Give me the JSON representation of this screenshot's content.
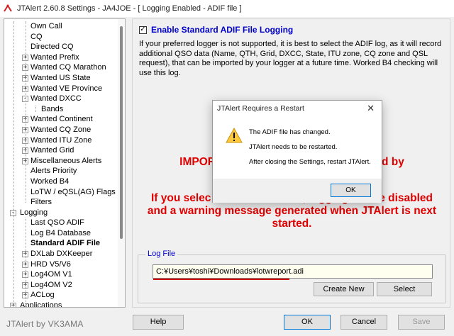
{
  "window": {
    "title": "JTAlert 2.60.8 Settings  -  JA4JOE  -  [ Logging Enabled - ADIF file ]"
  },
  "tree": {
    "items": [
      {
        "label": "Own Call"
      },
      {
        "label": "CQ"
      },
      {
        "label": "Directed CQ"
      },
      {
        "label": "Wanted Prefix",
        "expander": "+"
      },
      {
        "label": "Wanted CQ Marathon",
        "expander": "+"
      },
      {
        "label": "Wanted US State",
        "expander": "+"
      },
      {
        "label": "Wanted VE Province",
        "expander": "+"
      },
      {
        "label": "Wanted DXCC",
        "expander": "-"
      },
      {
        "label": "Bands"
      },
      {
        "label": "Wanted Continent",
        "expander": "+"
      },
      {
        "label": "Wanted CQ Zone",
        "expander": "+"
      },
      {
        "label": "Wanted ITU Zone",
        "expander": "+"
      },
      {
        "label": "Wanted Grid",
        "expander": "+"
      },
      {
        "label": "Miscellaneous Alerts",
        "expander": "+"
      },
      {
        "label": "Alerts Priority"
      },
      {
        "label": "Worked B4"
      },
      {
        "label": "LoTW / eQSL(AG) Flags"
      },
      {
        "label": "Filters"
      },
      {
        "label": "Logging",
        "expander": "-"
      },
      {
        "label": "Last QSO ADIF"
      },
      {
        "label": "Log B4 Database"
      },
      {
        "label": "Standard ADIF File",
        "selected": true
      },
      {
        "label": "DXLab DXKeeper",
        "expander": "+"
      },
      {
        "label": "HRD V5/V6",
        "expander": "+"
      },
      {
        "label": "Log4OM V1",
        "expander": "+"
      },
      {
        "label": "Log4OM V2",
        "expander": "+"
      },
      {
        "label": "ACLog",
        "expander": "+"
      },
      {
        "label": "Applications",
        "expander": "+"
      }
    ]
  },
  "panel": {
    "enable_checked": "✓",
    "enable_label": "Enable Standard ADIF File Logging",
    "description": "If your preferred logger is not supported, it is best to select the ADIF log, as it will record additional QSO data (Name, QTH, Grid, DXCC, State, ITU zone, CQ zone and QSL request), that can be imported by your logger at a future time. Worked B4 checking will use this log.",
    "important_text": "IMPORTANT:                                      uced by",
    "warning_text": "If you selec                              , logging will be disabled and a warning message generated when JTAlert is next started.",
    "logfile": {
      "legend": "Log File",
      "path": "C:¥Users¥toshi¥Downloads¥lotwreport.adi",
      "create_new": "Create New",
      "select": "Select"
    }
  },
  "footer": {
    "brand": "JTAlert by VK3AMA",
    "help": "Help",
    "ok": "OK",
    "cancel": "Cancel",
    "save": "Save"
  },
  "dialog": {
    "title": "JTAlert Requires a Restart",
    "close_glyph": "✕",
    "line1": "The ADIF file has changed.",
    "line2": "JTAlert needs to be restarted.",
    "line3": "After closing the Settings, restart JTAlert.",
    "ok": "OK"
  },
  "colors": {
    "accent_blue": "#0000c8",
    "warning_red": "#e00000",
    "underline_red": "#d00000",
    "input_bg": "#fffff0",
    "default_button_border": "#0078d7"
  }
}
